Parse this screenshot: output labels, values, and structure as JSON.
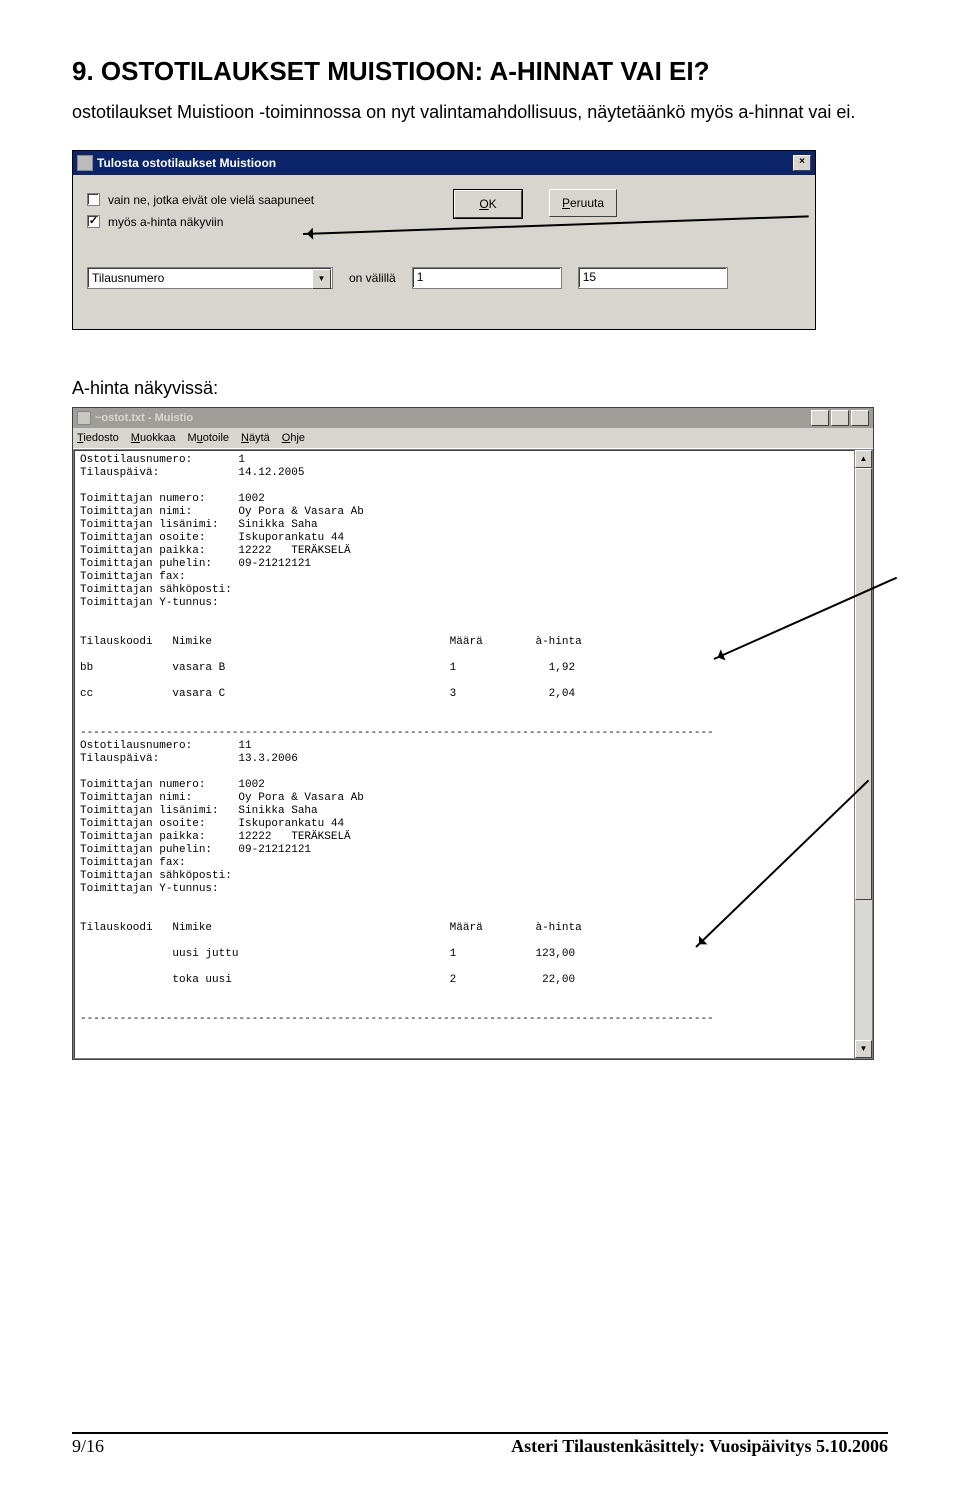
{
  "heading": "9. OSTOTILAUKSET MUISTIOON: A-HINNAT VAI EI?",
  "intro": "ostotilaukset Muistioon -toiminnossa on nyt valintamahdollisuus, näytetäänkö myös a-hinnat vai ei.",
  "dialog": {
    "title": "Tulosta ostotilaukset Muistioon",
    "cb1": "vain ne, jotka eivät ole vielä saapuneet",
    "cb2": "myös a-hinta näkyviin",
    "ok_html": "OK",
    "cancel_html": "Peruuta",
    "combo": "Tilausnumero",
    "between": "on välillä",
    "from": "1",
    "to": "15"
  },
  "subhead": "A-hinta näkyvissä:",
  "notepad": {
    "title": "~ostot.txt - Muistio",
    "menu": {
      "file": "Tiedosto",
      "edit": "Muokkaa",
      "format": "Muotoile",
      "view": "Näytä",
      "help": "Ohje"
    },
    "orders": [
      {
        "Ostotilausnumero": "1",
        "Tilauspäivä": "14.12.2005",
        "Toimittajan numero": "1002",
        "Toimittajan nimi": "Oy Pora & Vasara Ab",
        "Toimittajan lisänimi": "Sinikka Saha",
        "Toimittajan osoite": "Iskuporankatu 44",
        "Toimittajan paikka": "12222   TERÄKSELÄ",
        "Toimittajan puhelin": "09-21212121",
        "Toimittajan fax": "",
        "Toimittajan sähköposti": "",
        "Toimittajan Y-tunnus": "",
        "lines": [
          {
            "code": "bb",
            "name": "vasara B",
            "qty": "1",
            "aprice": "1,92"
          },
          {
            "code": "cc",
            "name": "vasara C",
            "qty": "3",
            "aprice": "2,04"
          }
        ]
      },
      {
        "Ostotilausnumero": "11",
        "Tilauspäivä": "13.3.2006",
        "Toimittajan numero": "1002",
        "Toimittajan nimi": "Oy Pora & Vasara Ab",
        "Toimittajan lisänimi": "Sinikka Saha",
        "Toimittajan osoite": "Iskuporankatu 44",
        "Toimittajan paikka": "12222   TERÄKSELÄ",
        "Toimittajan puhelin": "09-21212121",
        "Toimittajan fax": "",
        "Toimittajan sähköposti": "",
        "Toimittajan Y-tunnus": "",
        "lines": [
          {
            "code": "",
            "name": "uusi juttu",
            "qty": "1",
            "aprice": "123,00"
          },
          {
            "code": "",
            "name": "toka uusi",
            "qty": "2",
            "aprice": "22,00"
          }
        ]
      }
    ],
    "cols": {
      "code": "Tilauskoodi",
      "name": "Nimike",
      "qty": "Määrä",
      "aprice": "à-hinta"
    }
  },
  "footer": {
    "page": "9/16",
    "doc": "Asteri Tilaustenkäsittely: Vuosipäivitys 5.10.2006"
  }
}
